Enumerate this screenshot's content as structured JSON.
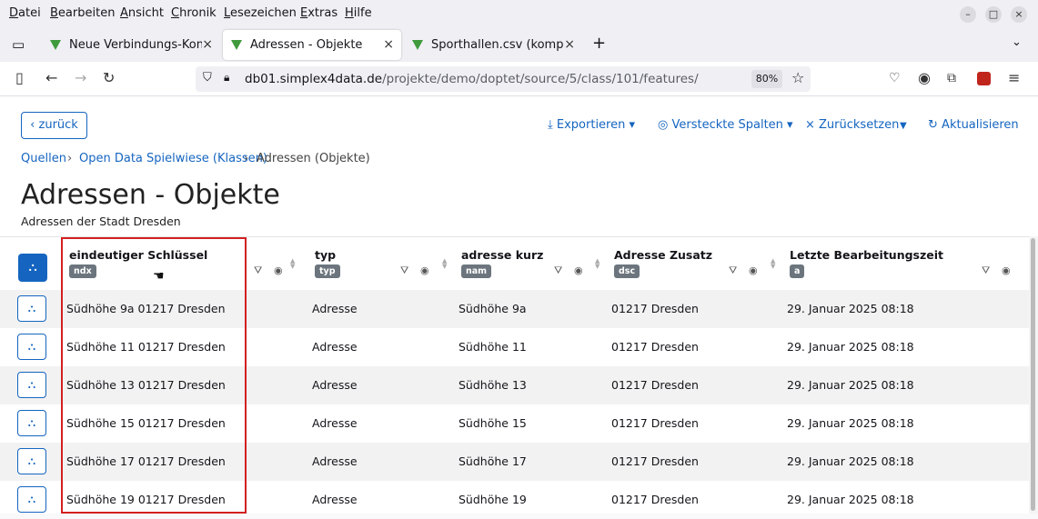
{
  "menu": [
    "Datei",
    "Bearbeiten",
    "Ansicht",
    "Chronik",
    "Lesezeichen",
    "Extras",
    "Hilfe"
  ],
  "tabs": [
    {
      "title": "Neue Verbindungs-Konve",
      "active": false
    },
    {
      "title": "Adressen - Objekte",
      "active": true
    },
    {
      "title": "Sporthallen.csv (komplett",
      "active": false
    }
  ],
  "nav": {
    "url_domain": "db01.simplex4data.de",
    "url_path": "/projekte/demo/doptet/source/5/class/101/features/",
    "zoom": "80%"
  },
  "toolbar": {
    "back": "‹ zurück",
    "export": "Exportieren ▾",
    "hidden_columns": "Versteckte Spalten ▾",
    "reset": "× Zurücksetzen",
    "refresh": "Aktualisieren"
  },
  "breadcrumb": [
    "Quellen",
    "Open Data Spielwiese (Klassen)",
    "Adressen (Objekte)"
  ],
  "page": {
    "title": "Adressen - Objekte",
    "subtitle": "Adressen der Stadt Dresden"
  },
  "columns": [
    {
      "name": "eindeutiger Schlüssel",
      "tag": "ndx"
    },
    {
      "name": "typ",
      "tag": "typ"
    },
    {
      "name": "adresse kurz",
      "tag": "nam"
    },
    {
      "name": "Adresse Zusatz",
      "tag": "dsc"
    },
    {
      "name": "Letzte Bearbeitungszeit",
      "tag": "a"
    }
  ],
  "rows": [
    [
      "Südhöhe 9a 01217 Dresden",
      "Adresse",
      "Südhöhe 9a",
      "01217 Dresden",
      "29. Januar 2025 08:18"
    ],
    [
      "Südhöhe 11 01217 Dresden",
      "Adresse",
      "Südhöhe 11",
      "01217 Dresden",
      "29. Januar 2025 08:18"
    ],
    [
      "Südhöhe 13 01217 Dresden",
      "Adresse",
      "Südhöhe 13",
      "01217 Dresden",
      "29. Januar 2025 08:18"
    ],
    [
      "Südhöhe 15 01217 Dresden",
      "Adresse",
      "Südhöhe 15",
      "01217 Dresden",
      "29. Januar 2025 08:18"
    ],
    [
      "Südhöhe 17 01217 Dresden",
      "Adresse",
      "Südhöhe 17",
      "01217 Dresden",
      "29. Januar 2025 08:18"
    ],
    [
      "Südhöhe 19 01217 Dresden",
      "Adresse",
      "Südhöhe 19",
      "01217 Dresden",
      "29. Januar 2025 08:18"
    ]
  ],
  "colors": {
    "accent": "#1565c0",
    "highlight": "#d32020"
  }
}
